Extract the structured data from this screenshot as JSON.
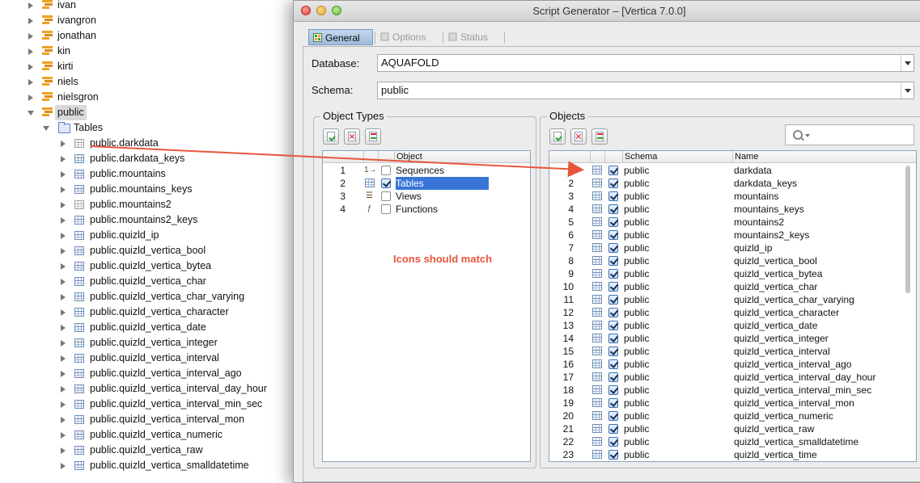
{
  "tree": {
    "schemas_above": [
      {
        "label": "ivan"
      },
      {
        "label": "ivangron"
      },
      {
        "label": "jonathan"
      },
      {
        "label": "kin"
      },
      {
        "label": "kirti"
      },
      {
        "label": "niels"
      },
      {
        "label": "nielsgron"
      }
    ],
    "selected_schema": {
      "label": "public"
    },
    "folder": {
      "label": "Tables"
    },
    "tables": [
      {
        "label": "public.darkdata"
      },
      {
        "label": "public.darkdata_keys"
      },
      {
        "label": "public.mountains"
      },
      {
        "label": "public.mountains_keys"
      },
      {
        "label": "public.mountains2"
      },
      {
        "label": "public.mountains2_keys"
      },
      {
        "label": "public.quizld_ip"
      },
      {
        "label": "public.quizld_vertica_bool"
      },
      {
        "label": "public.quizld_vertica_bytea"
      },
      {
        "label": "public.quizld_vertica_char"
      },
      {
        "label": "public.quizld_vertica_char_varying"
      },
      {
        "label": "public.quizld_vertica_character"
      },
      {
        "label": "public.quizld_vertica_date"
      },
      {
        "label": "public.quizld_vertica_integer"
      },
      {
        "label": "public.quizld_vertica_interval"
      },
      {
        "label": "public.quizld_vertica_interval_ago"
      },
      {
        "label": "public.quizld_vertica_interval_day_hour"
      },
      {
        "label": "public.quizld_vertica_interval_min_sec"
      },
      {
        "label": "public.quizld_vertica_interval_mon"
      },
      {
        "label": "public.quizld_vertica_numeric"
      },
      {
        "label": "public.quizld_vertica_raw"
      },
      {
        "label": "public.quizld_vertica_smalldatetime"
      }
    ]
  },
  "dialog": {
    "title": "Script Generator – [Vertica 7.0.0]",
    "tabs": [
      {
        "label": "General",
        "active": true
      },
      {
        "label": "Options",
        "active": false
      },
      {
        "label": "Status",
        "active": false
      }
    ],
    "database_label": "Database:",
    "database_value": "AQUAFOLD",
    "schema_label": "Schema:",
    "schema_value": "public",
    "object_types": {
      "title": "Object Types",
      "header": "Object",
      "rows": [
        {
          "num": "1",
          "label": "Sequences",
          "checked": false,
          "icon": "sequence-icon"
        },
        {
          "num": "2",
          "label": "Tables",
          "checked": true,
          "icon": "table-icon",
          "selected": true
        },
        {
          "num": "3",
          "label": "Views",
          "checked": false,
          "icon": "view-icon"
        },
        {
          "num": "4",
          "label": "Functions",
          "checked": false,
          "icon": "function-icon"
        }
      ]
    },
    "objects": {
      "title": "Objects",
      "headers": {
        "schema": "Schema",
        "name": "Name"
      },
      "rows": [
        {
          "num": "1",
          "schema": "public",
          "name": "darkdata"
        },
        {
          "num": "2",
          "schema": "public",
          "name": "darkdata_keys"
        },
        {
          "num": "3",
          "schema": "public",
          "name": "mountains"
        },
        {
          "num": "4",
          "schema": "public",
          "name": "mountains_keys"
        },
        {
          "num": "5",
          "schema": "public",
          "name": "mountains2"
        },
        {
          "num": "6",
          "schema": "public",
          "name": "mountains2_keys"
        },
        {
          "num": "7",
          "schema": "public",
          "name": "quizld_ip"
        },
        {
          "num": "8",
          "schema": "public",
          "name": "quizld_vertica_bool"
        },
        {
          "num": "9",
          "schema": "public",
          "name": "quizld_vertica_bytea"
        },
        {
          "num": "10",
          "schema": "public",
          "name": "quizld_vertica_char"
        },
        {
          "num": "11",
          "schema": "public",
          "name": "quizld_vertica_char_varying"
        },
        {
          "num": "12",
          "schema": "public",
          "name": "quizld_vertica_character"
        },
        {
          "num": "13",
          "schema": "public",
          "name": "quizld_vertica_date"
        },
        {
          "num": "14",
          "schema": "public",
          "name": "quizld_vertica_integer"
        },
        {
          "num": "15",
          "schema": "public",
          "name": "quizld_vertica_interval"
        },
        {
          "num": "16",
          "schema": "public",
          "name": "quizld_vertica_interval_ago"
        },
        {
          "num": "17",
          "schema": "public",
          "name": "quizld_vertica_interval_day_hour"
        },
        {
          "num": "18",
          "schema": "public",
          "name": "quizld_vertica_interval_min_sec"
        },
        {
          "num": "19",
          "schema": "public",
          "name": "quizld_vertica_interval_mon"
        },
        {
          "num": "20",
          "schema": "public",
          "name": "quizld_vertica_numeric"
        },
        {
          "num": "21",
          "schema": "public",
          "name": "quizld_vertica_raw"
        },
        {
          "num": "22",
          "schema": "public",
          "name": "quizld_vertica_smalldatetime"
        },
        {
          "num": "23",
          "schema": "public",
          "name": "quizld_vertica_time"
        }
      ]
    }
  },
  "annotation": {
    "note": "Icons should match",
    "color": "#e8553c"
  },
  "colors": {
    "selection": "#3875d7",
    "tab_active": "#9dbbdc"
  }
}
